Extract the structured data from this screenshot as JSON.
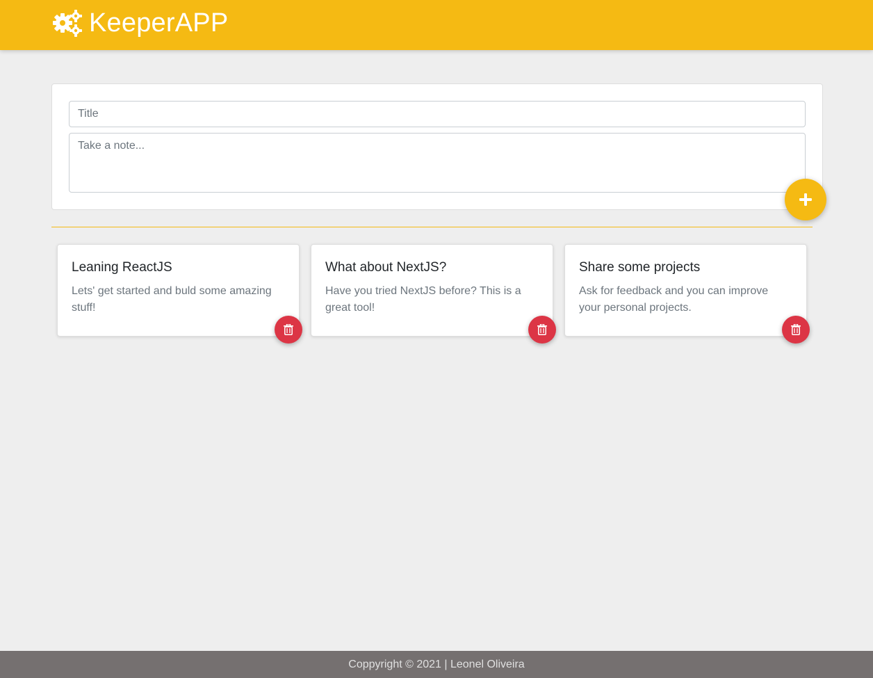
{
  "header": {
    "app_title": "KeeperAPP",
    "icon": "gears-icon",
    "brand_color": "#f5ba13"
  },
  "create_note": {
    "title_value": "",
    "title_placeholder": "Title",
    "content_value": "",
    "content_placeholder": "Take a note...",
    "add_button_icon": "plus-icon",
    "add_button_color": "#f5ba13"
  },
  "notes": [
    {
      "title": "Leaning ReactJS",
      "content": "Lets' get started and buld some amazing stuff!",
      "delete_icon": "trash-icon"
    },
    {
      "title": "What about NextJS?",
      "content": "Have you tried NextJS before? This is a great tool!",
      "delete_icon": "trash-icon"
    },
    {
      "title": "Share some projects",
      "content": "Ask for feedback and you can improve your personal projects.",
      "delete_icon": "trash-icon"
    }
  ],
  "delete_button_color": "#dc3545",
  "footer": {
    "text": "Coppyright © 2021 | Leonel Oliveira",
    "background_color": "#757070"
  }
}
